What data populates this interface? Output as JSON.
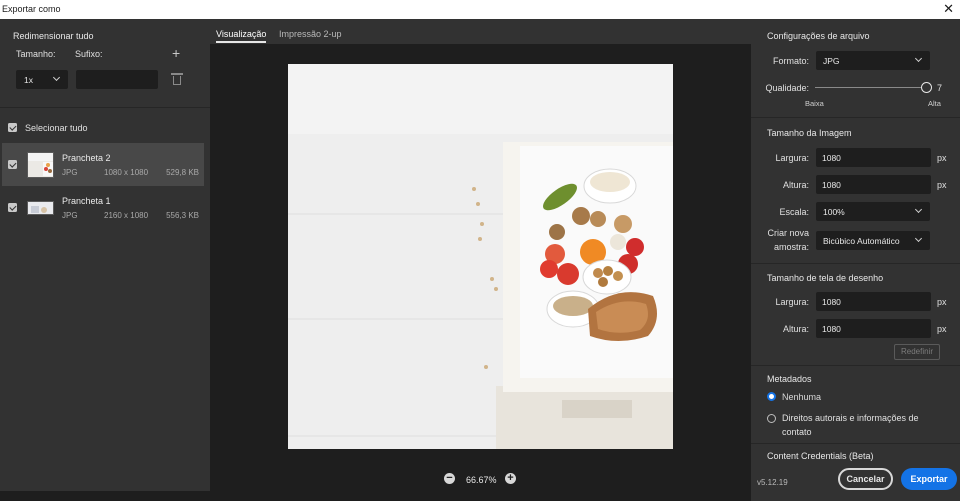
{
  "window": {
    "title": "Exportar como"
  },
  "left": {
    "resize_title": "Redimensionar tudo",
    "size_label": "Tamanho:",
    "suffix_label": "Sufixo:",
    "scale_value": "1x",
    "suffix_value": "",
    "select_all_label": "Selecionar tudo",
    "assets": [
      {
        "name": "Prancheta 2",
        "format": "JPG",
        "dimensions": "1080 x 1080",
        "size": "529,8 KB",
        "selected": true
      },
      {
        "name": "Prancheta 1",
        "format": "JPG",
        "dimensions": "2160 x 1080",
        "size": "556,3 KB",
        "selected": false
      }
    ]
  },
  "center": {
    "tabs": [
      {
        "label": "Visualização",
        "active": true
      },
      {
        "label": "Impressão 2-up",
        "active": false
      }
    ],
    "zoom": "66.67%"
  },
  "right": {
    "file_settings": {
      "title": "Configurações de arquivo",
      "format_label": "Formato:",
      "format_value": "JPG",
      "quality_label": "Qualidade:",
      "quality_value": "7",
      "quality_low": "Baixa",
      "quality_high": "Alta"
    },
    "image_size": {
      "title": "Tamanho da Imagem",
      "width_label": "Largura:",
      "width_value": "1080",
      "height_label": "Altura:",
      "height_value": "1080",
      "unit": "px",
      "scale_label": "Escala:",
      "scale_value": "100%",
      "resample_label_1": "Criar nova",
      "resample_label_2": "amostra:",
      "resample_value": "Bicúbico Automático"
    },
    "canvas_size": {
      "title": "Tamanho de tela de desenho",
      "width_label": "Largura:",
      "width_value": "1080",
      "height_label": "Altura:",
      "height_value": "1080",
      "unit": "px",
      "reset_label": "Redefinir"
    },
    "metadata": {
      "title": "Metadados",
      "options": [
        {
          "label": "Nenhuma",
          "checked": true
        },
        {
          "label_1": "Direitos autorais e informações de",
          "label_2": "contato",
          "checked": false
        }
      ]
    },
    "content_credentials": {
      "title": "Content Credentials (Beta)"
    },
    "footer": {
      "version": "v5.12.19",
      "cancel_label": "Cancelar",
      "export_label": "Exportar"
    }
  },
  "colors": {
    "accent": "#1473e6",
    "panel": "#323232",
    "canvas": "#1e1e1e"
  }
}
